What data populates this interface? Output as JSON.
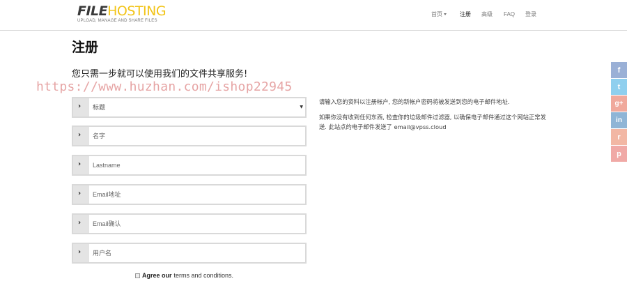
{
  "logo": {
    "part1": "FILE",
    "part2": "HOSTING",
    "tagline": "UPLOAD, MANAGE AND SHARE FILES"
  },
  "nav": {
    "home": "首页",
    "register": "注册",
    "premium": "高级",
    "faq": "FAQ",
    "login": "登录"
  },
  "page": {
    "title": "注册",
    "subtitle": "您只需一步就可以使用我们的文件共享服务!"
  },
  "watermark": "https://www.huzhan.com/ishop22945",
  "form": {
    "title_select": {
      "value": "标题"
    },
    "first_name": {
      "placeholder": "名字"
    },
    "last_name": {
      "placeholder": "Lastname"
    },
    "email": {
      "placeholder": "Email地址"
    },
    "email_confirm": {
      "placeholder": "Email确认"
    },
    "username": {
      "placeholder": "用户名"
    },
    "agree": {
      "prefix": "Agree our",
      "link": "terms and conditions."
    }
  },
  "info": {
    "line1": "请输入您的资料以注册帐户, 您的新帐户密码将被发送到您的电子邮件地址.",
    "line2": "如果你没有收到任何东西, 检查你的垃圾邮件过滤器, 以确保电子邮件通过这个网站正常发送. 此站点的电子邮件发送了 email@vpss.cloud"
  },
  "social": [
    {
      "icon": "facebook-icon",
      "glyph": "f",
      "color": "#9ab0d6"
    },
    {
      "icon": "twitter-icon",
      "glyph": "t",
      "color": "#8fcfee"
    },
    {
      "icon": "google-plus-icon",
      "glyph": "g+",
      "color": "#f0a99c"
    },
    {
      "icon": "linkedin-icon",
      "glyph": "in",
      "color": "#8fb5d6"
    },
    {
      "icon": "reddit-icon",
      "glyph": "r",
      "color": "#f2b7a4"
    },
    {
      "icon": "pinterest-icon",
      "glyph": "p",
      "color": "#f0a9a6"
    }
  ]
}
